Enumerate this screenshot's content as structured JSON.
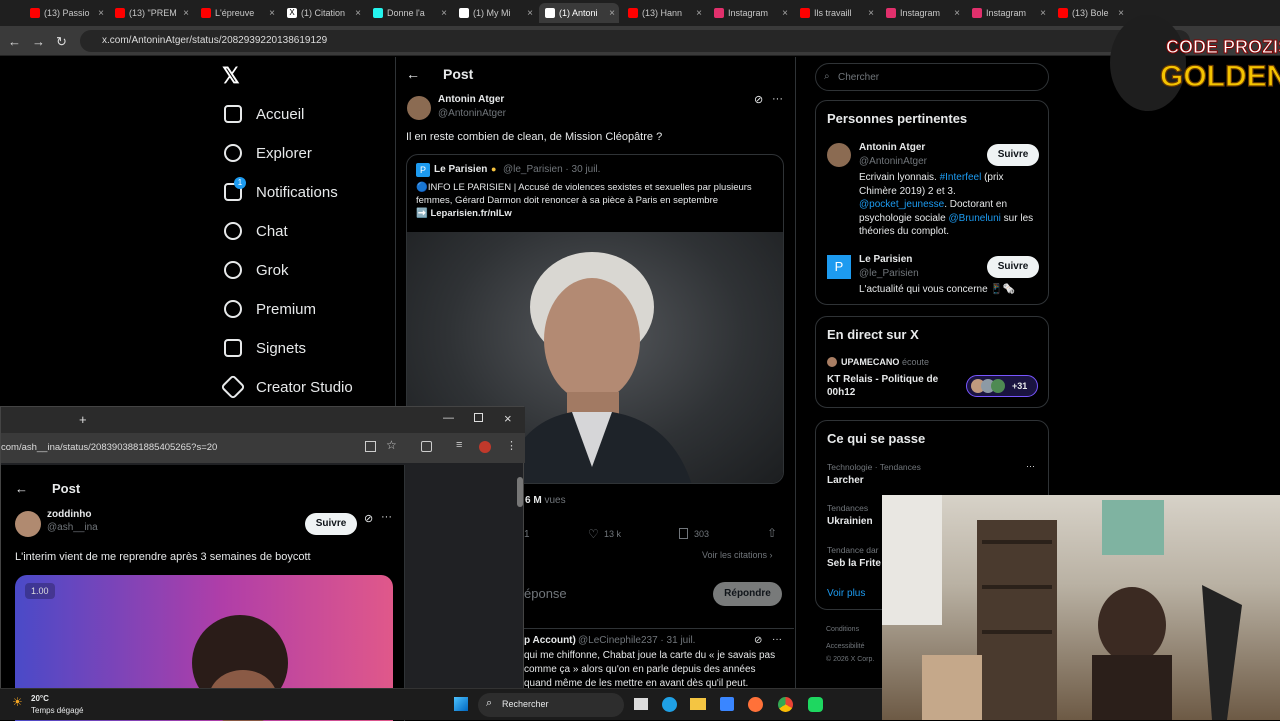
{
  "tabs": [
    {
      "label": "(13) Passio",
      "color": "#ff0000"
    },
    {
      "label": "(13) \"PREM",
      "color": "#ff0000"
    },
    {
      "label": "L'épreuve",
      "color": "#ff0000"
    },
    {
      "label": "(1) Citation",
      "color": "#ffffff"
    },
    {
      "label": "Donne l'a",
      "color": "#ffffff"
    },
    {
      "label": "(1) My Mi",
      "color": "#ffffff"
    },
    {
      "label": "(1) Antoni",
      "color": "#ffffff"
    },
    {
      "label": "(13) Hann",
      "color": "#ff0000"
    },
    {
      "label": "Instagram",
      "color": "#e1306c"
    },
    {
      "label": "Ils travaill",
      "color": "#ff0000"
    },
    {
      "label": "Instagram",
      "color": "#e1306c"
    },
    {
      "label": "Instagram",
      "color": "#e1306c"
    },
    {
      "label": "(13) Bole",
      "color": "#ff0000"
    }
  ],
  "browser": {
    "url": "x.com/AntoninAtger/status/2082939220138619129"
  },
  "nav": {
    "items": [
      "Accueil",
      "Explorer",
      "Notifications",
      "Chat",
      "Grok",
      "Premium",
      "Signets",
      "Creator Studio"
    ],
    "notif_badge": "1"
  },
  "post": {
    "header": "Post",
    "author_name": "Antonin Atger",
    "author_handle": "@AntoninAtger",
    "text": "Il en reste combien de clean, de Mission Cléopâtre ?",
    "quote": {
      "name": "Le Parisien",
      "handle": "@le_Parisien · 30 juil.",
      "text": "🔵INFO LE PARISIEN | Accusé de violences sexistes et sexuelles par plusieurs femmes, Gérard Darmon doit renoncer à sa pièce à Paris en septembre",
      "link": "➡️ Leparisien.fr/nILw"
    },
    "views": "6 M",
    "views_label": "vues",
    "stat_replies": "1",
    "likes": "13 k",
    "bookmarks": "303",
    "citations": "Voir les citations ›",
    "reply_placeholder": "éponse",
    "reply_button": "Répondre",
    "reply": {
      "name": "p Account)",
      "handle": "@LeCinephile237 · 31 juil.",
      "lines": [
        "qui me chiffonne, Chabat joue la carte du « je savais pas",
        "comme ça » alors qu'on en parle depuis des années",
        "quand même de les mettre en avant dès qu'il peut."
      ]
    }
  },
  "right": {
    "search_placeholder": "Chercher",
    "relevant_title": "Personnes pertinentes",
    "p1_name": "Antonin Atger",
    "p1_handle": "@AntoninAtger",
    "p1_bio_a": "Ecrivain lyonnais. ",
    "p1_bio_b": "#Interfeel",
    "p1_bio_c": " (prix Chimère 2019) 2 et 3. ",
    "p1_bio_d": "@pocket_jeunesse",
    "p1_bio_e": ". Doctorant en psychologie sociale ",
    "p1_bio_f": "@Bruneluni",
    "p1_bio_g": " sur les théories du complot.",
    "p2_name": "Le Parisien",
    "p2_handle": "@le_Parisien",
    "p2_bio": "L'actualité qui vous concerne 📱🗞️",
    "follow": "Suivre",
    "live_title": "En direct sur X",
    "live_host": "UPAMECANO",
    "live_host_action": "écoute",
    "live_name": "KT Relais - Politique de 00h12",
    "live_count": "+31",
    "trends_title": "Ce qui se passe",
    "trends": [
      {
        "meta": "Technologie · Tendances",
        "name": "Larcher"
      },
      {
        "meta": "Tendances",
        "name": "Ukrainien"
      },
      {
        "meta": "Tendance dar",
        "name": "Seb la Frite"
      }
    ],
    "see_more": "Voir plus",
    "footer": [
      "Conditions",
      "Accessibilité",
      "© 2026 X Corp."
    ]
  },
  "window2": {
    "url": "com/ash__ina/status/2083903881885405265?s=20",
    "header": "Post",
    "name": "zoddinho",
    "handle": "@ash__ina",
    "follow": "Suivre",
    "text": "L'interim vient de me reprendre après 3 semaines de boycott",
    "video_time": "1.00"
  },
  "taskbar": {
    "temp": "20°C",
    "weather": "Temps dégagé",
    "search": "Rechercher"
  },
  "overlay": {
    "logo_line1": "CODE PROZIS",
    "logo_line2": "GOLDENG"
  }
}
